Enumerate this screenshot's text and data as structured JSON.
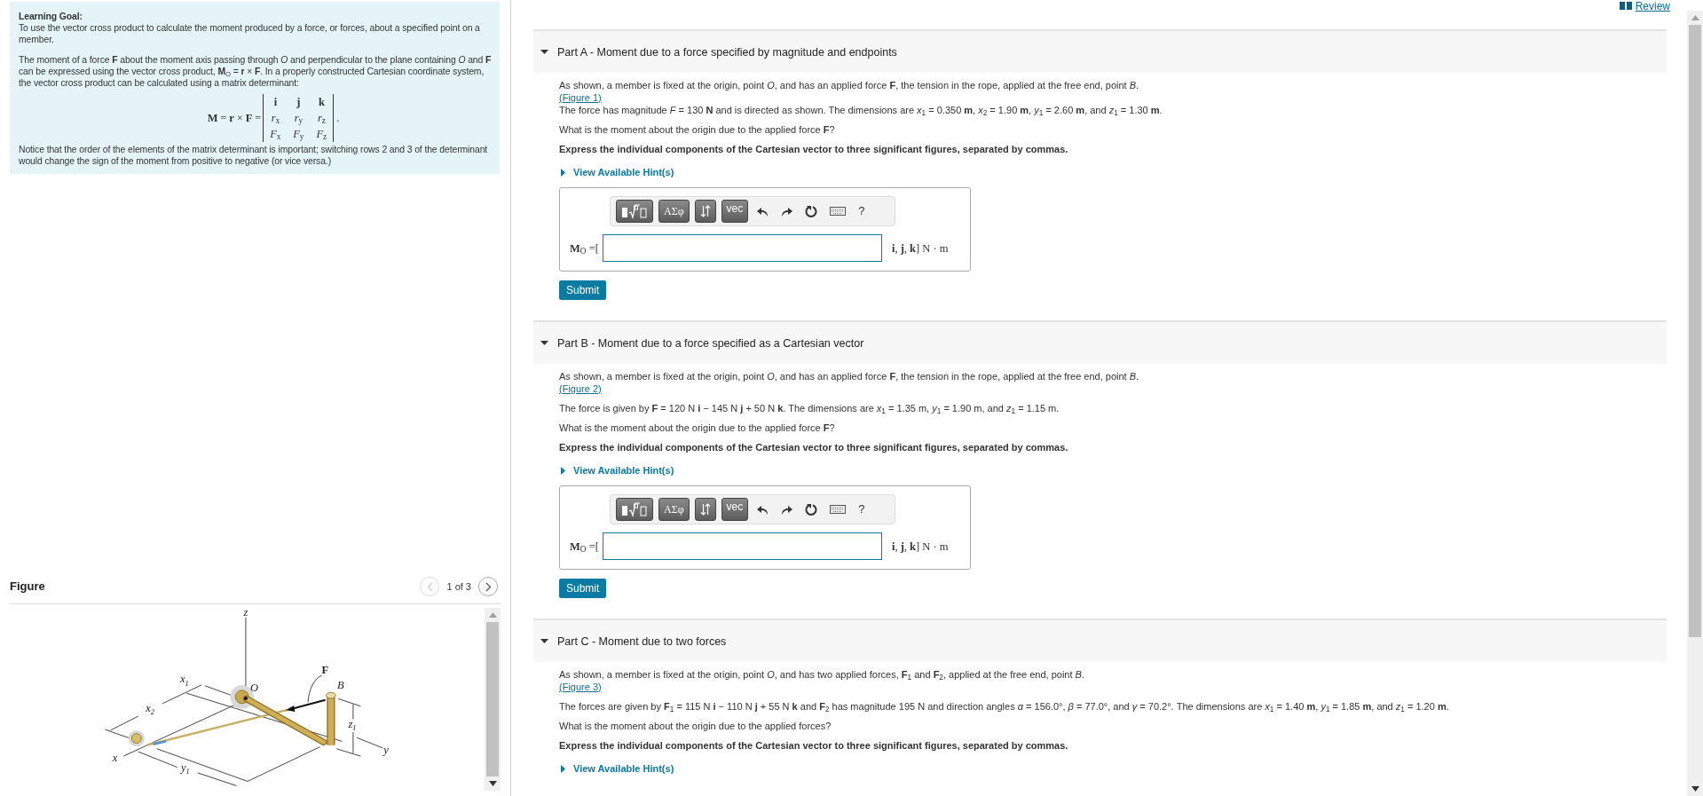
{
  "review_link": "Review",
  "learning_goal": {
    "heading": "Learning Goal:",
    "intro": "To use the vector cross product to calculate the moment produced by a force, or forces, about a specified point on a member.",
    "paragraph": "The moment of a force **F** about the moment axis passing through *O* and perpendicular to the plane containing *O* and **F** can be expressed using the vector cross product, **M**$_{O}$ = **r** × **F**. In a properly constructed Cartesian coordinate system, the vector cross product can be calculated using a matrix determinant:",
    "equation": {
      "lhs": "**M** = **r** × **F** =",
      "matrix": [
        [
          "**i**",
          "**j**",
          "**k**"
        ],
        [
          "*r*$_{x}$",
          "*r*$_{y}$",
          "*r*$_{z}$"
        ],
        [
          "*F*$_{x}$",
          "*F*$_{y}$",
          "*F*$_{z}$"
        ]
      ],
      "end": "."
    },
    "note": "Notice that the order of the elements of the matrix determinant is important; switching rows 2 and 3 of the determinant would change the sign of the moment from positive to negative (or vice versa.)"
  },
  "figure": {
    "title": "Figure",
    "pager": "1 of 3",
    "prev_disabled": true,
    "next_disabled": false,
    "labels": [
      {
        "kind": "axis",
        "text": "z"
      },
      {
        "kind": "dimension",
        "text": "x",
        "sub": "1"
      },
      {
        "kind": "dimension",
        "text": "x",
        "sub": "2"
      },
      {
        "kind": "point",
        "text": "O"
      },
      {
        "kind": "force",
        "text": "F"
      },
      {
        "kind": "point",
        "text": "B"
      },
      {
        "kind": "dimension",
        "text": "z",
        "sub": "1"
      },
      {
        "kind": "axis",
        "text": "y"
      },
      {
        "kind": "axis",
        "text": "x"
      },
      {
        "kind": "dimension",
        "text": "y",
        "sub": "1"
      }
    ]
  },
  "parts": [
    {
      "title": "Part A - Moment due to a force specified by magnitude and endpoints",
      "expanded": true,
      "intro": "As shown, a member is fixed at the origin, point *O*, and has an applied force **F**, the tension in the rope, applied at the free end, point *B*.",
      "figure_link": "(Figure 1)",
      "given": "The force has magnitude *F* = 130 **N** and is directed as shown. The dimensions are *x*$_{1}$ = 0.350 **m**, *x*$_{2}$ = 1.90 **m**, *y*$_{1}$ = 2.60 **m**, and *z*$_{1}$ = 1.30 **m**.",
      "question": "What is the moment about the origin due to the applied force **F**?",
      "instruction": "Express the individual components of the Cartesian vector to three significant figures, separated by commas.",
      "hint": {
        "label": "View Available Hint(s)",
        "expanded": false
      },
      "answer": {
        "toolbar": [
          {
            "kind": "templates"
          },
          {
            "kind": "symbols",
            "label": "ΑΣφ"
          },
          {
            "kind": "arrows"
          },
          {
            "kind": "vector",
            "label": "vec"
          },
          {
            "kind": "undo"
          },
          {
            "kind": "redo"
          },
          {
            "kind": "reset"
          },
          {
            "kind": "keyboard"
          },
          {
            "kind": "help",
            "label": "?"
          }
        ],
        "label": "**M**$_{O}$ =[",
        "units": "**i**, **j**, **k**] N · m"
      },
      "submit": "Submit"
    },
    {
      "title": "Part B - Moment due to a force specified as a Cartesian vector",
      "expanded": true,
      "intro": "As shown, a member is fixed at the origin, point *O*, and has an applied force **F**, the tension in the rope, applied at the free end, point *B*.",
      "figure_link": "(Figure 2)",
      "given": "The force is given by **F** = 120 N **i** − 145 N **j** + 50 N **k**. The dimensions are *x*$_{1}$ = 1.35 m, *y*$_{1}$ = 1.90 m, and *z*$_{1}$ = 1.15 m.",
      "question": "What is the moment about the origin due to the applied force **F**?",
      "instruction": "Express the individual components of the Cartesian vector to three significant figures, separated by commas.",
      "hint": {
        "label": "View Available Hint(s)",
        "expanded": false
      },
      "answer": {
        "toolbar": [
          {
            "kind": "templates"
          },
          {
            "kind": "symbols",
            "label": "ΑΣφ"
          },
          {
            "kind": "arrows"
          },
          {
            "kind": "vector",
            "label": "vec"
          },
          {
            "kind": "undo"
          },
          {
            "kind": "redo"
          },
          {
            "kind": "reset"
          },
          {
            "kind": "keyboard"
          },
          {
            "kind": "help",
            "label": "?"
          }
        ],
        "label": "**M**$_{O}$ =[",
        "units": "**i**, **j**, **k**] N · m"
      },
      "submit": "Submit"
    },
    {
      "title": "Part C - Moment due to two forces",
      "expanded": true,
      "intro": "As shown, a member is fixed at the origin, point *O*, and has two applied forces, **F**$_{1}$ and **F**$_{2}$, applied at the free end, point *B*.",
      "figure_link": "(Figure 3)",
      "given": "The forces are given by **F**$_{1}$ = 115 N **i** − 110 N **j** + 55 N **k** and **F**$_{2}$ has magnitude 195 N and direction angles *α* = 156.0°, *β* = 77.0°, and *γ* = 70.2°. The dimensions are *x*$_{1}$ = 1.40 **m**, *y*$_{1}$ = 1.85 **m**, and *z*$_{1}$ = 1.20 **m**.",
      "question": "What is the moment about the origin due to the applied forces?",
      "instruction": "Express the individual components of the Cartesian vector to three significant figures, separated by commas.",
      "hint": {
        "label": "View Available Hint(s)",
        "expanded": false
      }
    }
  ]
}
